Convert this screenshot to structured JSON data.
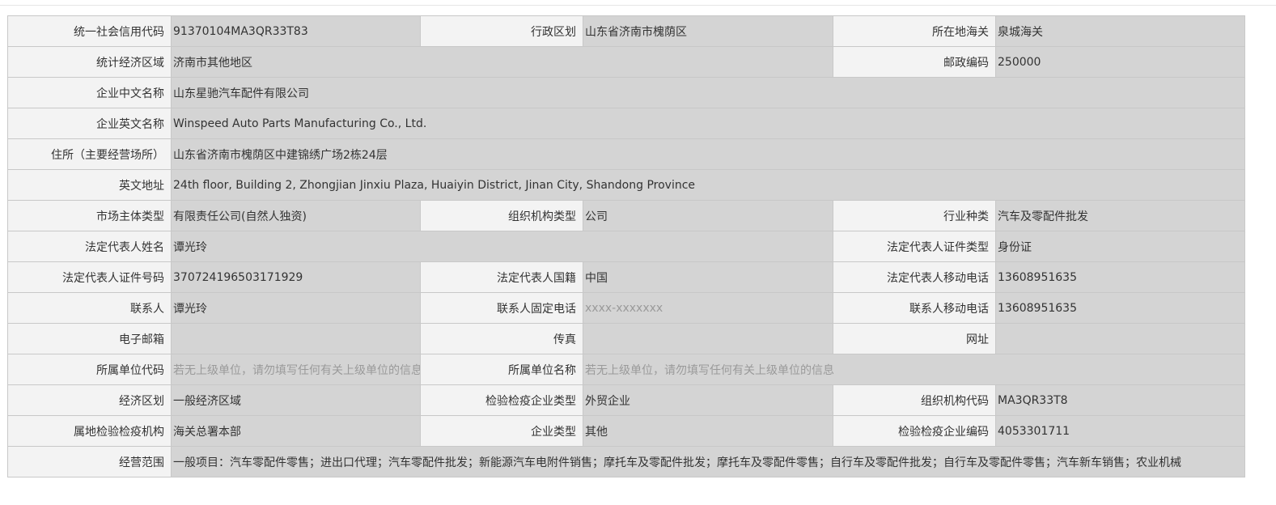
{
  "rows": [
    [
      {
        "label": "统一社会信用代码",
        "value": "91370104MA3QR33T83"
      },
      {
        "label": "行政区划",
        "value": "山东省济南市槐荫区"
      },
      {
        "label": "所在地海关",
        "value": "泉城海关"
      }
    ],
    [
      {
        "label": "统计经济区域",
        "value": "济南市其他地区"
      },
      {
        "label": "邮政编码",
        "value": "250000"
      }
    ],
    [
      {
        "label": "企业中文名称",
        "value": "山东星驰汽车配件有限公司"
      }
    ],
    [
      {
        "label": "企业英文名称",
        "value": "Winspeed Auto Parts Manufacturing Co., Ltd."
      }
    ],
    [
      {
        "label": "住所（主要经营场所）",
        "value": "山东省济南市槐荫区中建锦绣广场2栋24层"
      }
    ],
    [
      {
        "label": "英文地址",
        "value": "24th floor, Building 2, Zhongjian Jinxiu Plaza, Huaiyin District, Jinan City, Shandong Province"
      }
    ],
    [
      {
        "label": "市场主体类型",
        "value": "有限责任公司(自然人独资)"
      },
      {
        "label": "组织机构类型",
        "value": "公司"
      },
      {
        "label": "行业种类",
        "value": "汽车及零配件批发"
      }
    ],
    [
      {
        "label": "法定代表人姓名",
        "value": "谭光玲"
      },
      {
        "label": "法定代表人证件类型",
        "value": "身份证"
      }
    ],
    [
      {
        "label": "法定代表人证件号码",
        "value": "370724196503171929"
      },
      {
        "label": "法定代表人国籍",
        "value": "中国"
      },
      {
        "label": "法定代表人移动电话",
        "value": "13608951635"
      }
    ],
    [
      {
        "label": "联系人",
        "value": "谭光玲"
      },
      {
        "label": "联系人固定电话",
        "value": "",
        "placeholder": "xxxx-xxxxxxx"
      },
      {
        "label": "联系人移动电话",
        "value": "13608951635"
      }
    ],
    [
      {
        "label": "电子邮箱",
        "value": ""
      },
      {
        "label": "传真",
        "value": ""
      },
      {
        "label": "网址",
        "value": ""
      }
    ],
    [
      {
        "label": "所属单位代码",
        "value": "",
        "placeholder": "若无上级单位，请勿填写任何有关上级单位的信息"
      },
      {
        "label": "所属单位名称",
        "value": "",
        "placeholder": "若无上级单位，请勿填写任何有关上级单位的信息"
      }
    ],
    [
      {
        "label": "经济区划",
        "value": "一般经济区域"
      },
      {
        "label": "检验检疫企业类型",
        "value": "外贸企业"
      },
      {
        "label": "组织机构代码",
        "value": "MA3QR33T8"
      }
    ],
    [
      {
        "label": "属地检验检疫机构",
        "value": "海关总署本部"
      },
      {
        "label": "企业类型",
        "value": "其他"
      },
      {
        "label": "检验检疫企业编码",
        "value": "4053301711"
      }
    ],
    [
      {
        "label": "经营范围",
        "value": "一般项目：汽车零配件零售；进出口代理；汽车零配件批发；新能源汽车电附件销售；摩托车及零配件批发；摩托车及零配件零售；自行车及零配件批发；自行车及零配件零售；汽车新车销售；农业机械"
      }
    ]
  ]
}
